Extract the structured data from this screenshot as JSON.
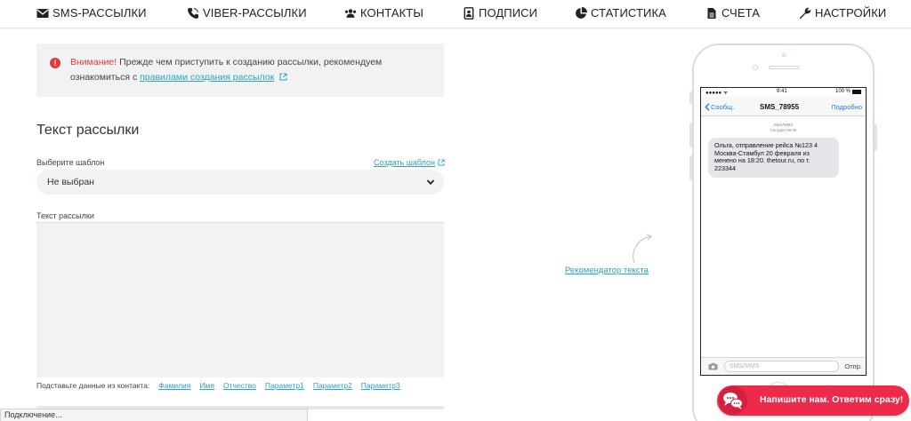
{
  "nav": {
    "items": [
      {
        "label": "SMS-РАССЫЛКИ",
        "icon": "envelope-icon"
      },
      {
        "label": "VIBER-РАССЫЛКИ",
        "icon": "phone-icon"
      },
      {
        "label": "КОНТАКТЫ",
        "icon": "users-icon"
      },
      {
        "label": "ПОДПИСИ",
        "icon": "id-card-icon"
      },
      {
        "label": "СТАТИСТИКА",
        "icon": "pie-chart-icon"
      },
      {
        "label": "СЧЕТА",
        "icon": "document-icon"
      },
      {
        "label": "НАСТРОЙКИ",
        "icon": "wrench-icon"
      }
    ]
  },
  "alert": {
    "warning_word": "Внимание!",
    "text_part1": " Прежде чем приступить к созданию рассылки, рекомендуем",
    "text_part2": "ознакомиться с ",
    "link_text": "правилами создания рассылок"
  },
  "form": {
    "section_title": "Текст рассылки",
    "template_label": "Выберите шаблон",
    "create_template_link": "Создать шаблон",
    "template_selected": "Не выбран",
    "text_label": "Текст рассылки",
    "substitute_label": "Подставьте данные из контакта:",
    "substitute_fields": [
      "Фамилия",
      "Имя",
      "Отчество",
      "Параметр1",
      "Параметр2",
      "Параметр3"
    ]
  },
  "recommender_link": "Рекомендатор текста",
  "phone": {
    "status_time": "9:41",
    "status_battery": "100 %",
    "back_label": "Сообщ.",
    "sender": "SMS_78955",
    "details_label": "Подробно",
    "meta_line1": "SMS/MMS",
    "meta_line2": "Сегодня 09:39",
    "message": "Ольга, отправление рейса №123 4 Москва-Стамбул 20 февраля из менено на 18:20. thetour.ru, по т. 223344",
    "composer_placeholder": "SMS/MMS",
    "send_label": "Отпр."
  },
  "chat_widget": {
    "text": "Напишите нам. Ответим сразу!"
  },
  "browser_status": "Подключение...",
  "colors": {
    "accent_link": "#2aa3c4",
    "warning": "#e23a3a",
    "chat_widget": "#ee2a4a",
    "ios_blue": "#1a7fe0"
  }
}
